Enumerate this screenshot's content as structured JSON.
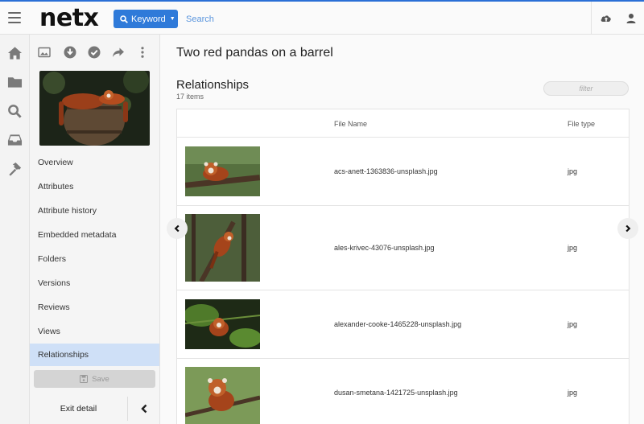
{
  "app": {
    "logo": "netx",
    "search_mode": "Keyword",
    "search_placeholder": "Search"
  },
  "left_rail": [
    "home-icon",
    "folder-icon",
    "search-icon",
    "inbox-icon",
    "hammer-icon"
  ],
  "toolbar_icons": [
    "image-icon",
    "download-icon",
    "check-circle-icon",
    "share-icon",
    "more-vertical-icon"
  ],
  "nav": {
    "items": [
      {
        "label": "Overview"
      },
      {
        "label": "Attributes"
      },
      {
        "label": "Attribute history"
      },
      {
        "label": "Embedded metadata"
      },
      {
        "label": "Folders"
      },
      {
        "label": "Versions"
      },
      {
        "label": "Reviews"
      },
      {
        "label": "Views"
      },
      {
        "label": "Relationships"
      }
    ],
    "active": "Relationships",
    "save_label": "Save",
    "exit_label": "Exit detail"
  },
  "asset": {
    "title": "Two red pandas on a barrel"
  },
  "relationships": {
    "title": "Relationships",
    "count": "17 items",
    "filter_placeholder": "filter",
    "columns": {
      "file_name": "File Name",
      "file_type": "File type"
    },
    "rows": [
      {
        "file_name": "acs-anett-1363836-unsplash.jpg",
        "file_type": "jpg"
      },
      {
        "file_name": "ales-krivec-43076-unsplash.jpg",
        "file_type": "jpg"
      },
      {
        "file_name": "alexander-cooke-1465228-unsplash.jpg",
        "file_type": "jpg"
      },
      {
        "file_name": "dusan-smetana-1421725-unsplash.jpg",
        "file_type": "jpg"
      }
    ]
  },
  "colors": {
    "accent": "#2f7ad9",
    "active_nav": "#cfe0f7",
    "top_border": "#2a6fd6"
  }
}
